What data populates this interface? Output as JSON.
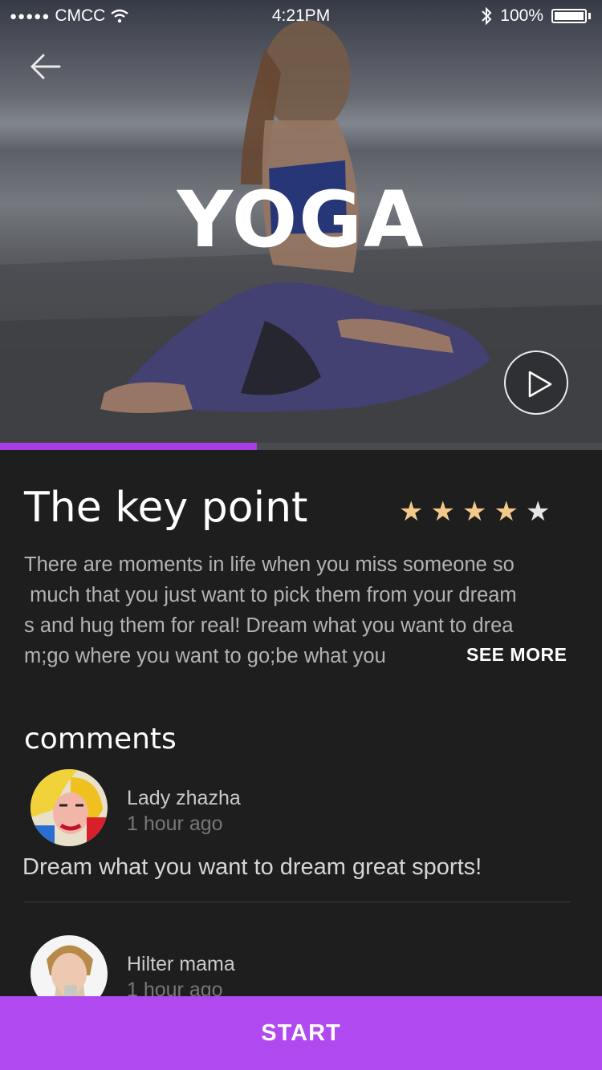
{
  "status_bar": {
    "signal": "●●●●●",
    "carrier": "CMCC",
    "time": "4:21PM",
    "battery": "100%"
  },
  "hero": {
    "title": "YOGA",
    "progress_fraction": 0.427
  },
  "section": {
    "title": "The key point",
    "rating": {
      "filled": 4,
      "total": 5,
      "filled_color": "#f3c98b",
      "empty_color": "#e6e6e6"
    },
    "description_lines": [
      "There are moments in life when you miss someone so",
      " much that you just want to pick them from your dream",
      "s and hug them for real! Dream what you want to drea",
      "m;go where you want to go;be what you"
    ],
    "see_more": "SEE MORE"
  },
  "comments": {
    "title": "comments",
    "items": [
      {
        "name": "Lady zhazha",
        "time": "1 hour ago",
        "text": "Dream what you want to dream great sports!"
      },
      {
        "name": "Hilter mama",
        "time": "1 hour ago",
        "text": ""
      }
    ]
  },
  "footer": {
    "start_label": "START"
  },
  "colors": {
    "accent": "#b049ef",
    "progress": "#a93ee6",
    "background": "#1e1e1e"
  }
}
